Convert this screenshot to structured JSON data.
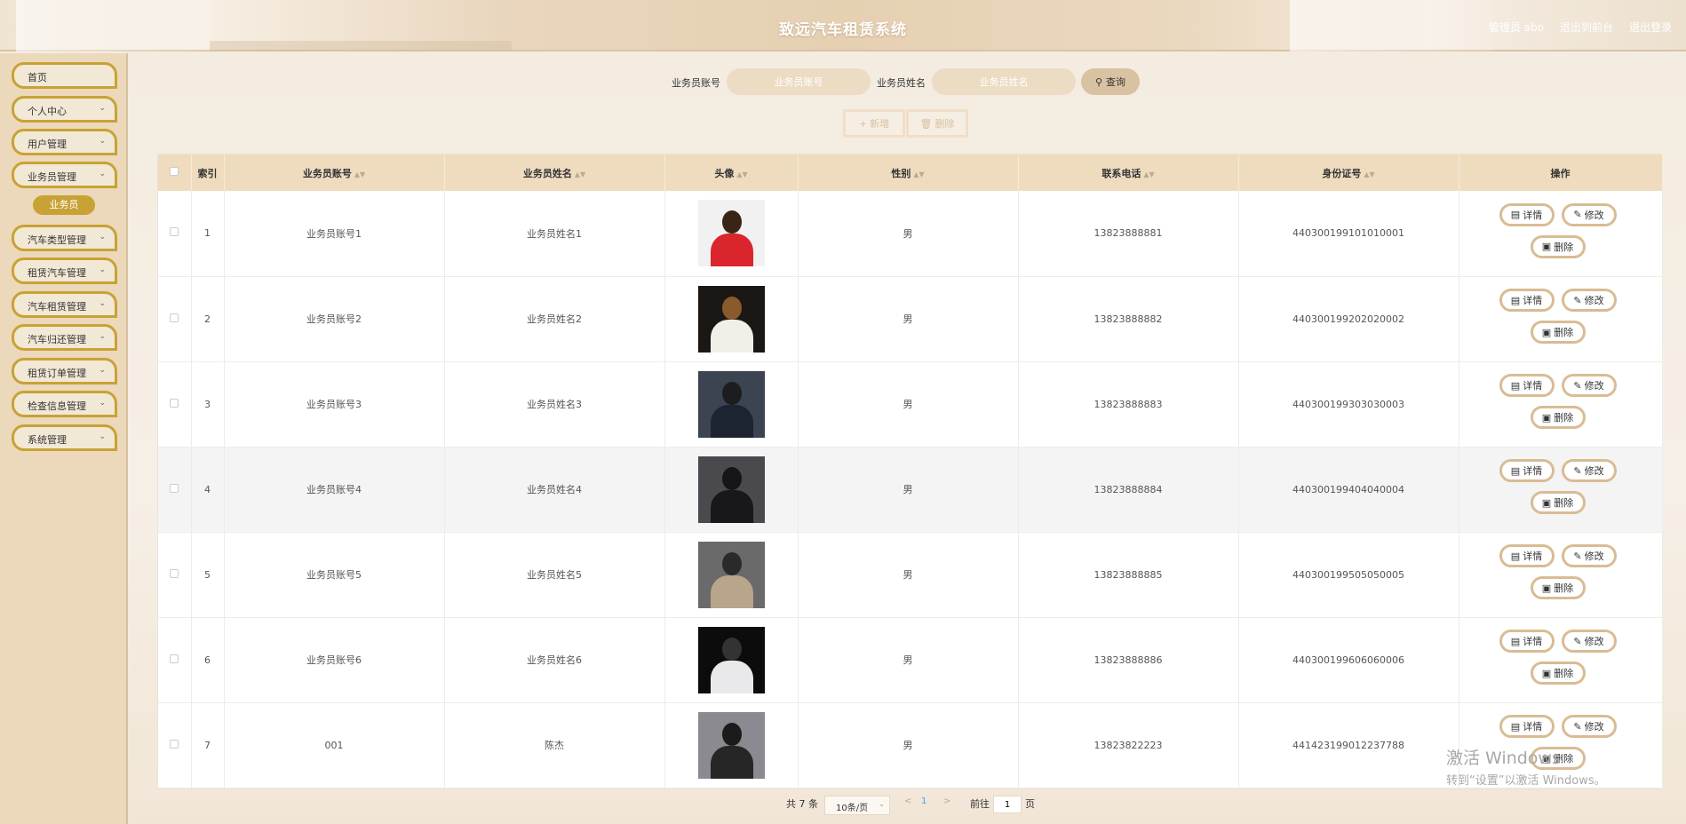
{
  "header": {
    "title": "致远汽车租赁系统",
    "user_label": "管理员 abo",
    "back_to_front": "退出到前台",
    "logout": "退出登录"
  },
  "sidebar": {
    "items": [
      {
        "label": "首页",
        "has_chevron": false
      },
      {
        "label": "个人中心",
        "has_chevron": true
      },
      {
        "label": "用户管理",
        "has_chevron": true
      },
      {
        "label": "业务员管理",
        "has_chevron": true
      },
      {
        "label": "汽车类型管理",
        "has_chevron": true
      },
      {
        "label": "租赁汽车管理",
        "has_chevron": true
      },
      {
        "label": "汽车租赁管理",
        "has_chevron": true
      },
      {
        "label": "汽车归还管理",
        "has_chevron": true
      },
      {
        "label": "租赁订单管理",
        "has_chevron": true
      },
      {
        "label": "检查信息管理",
        "has_chevron": true
      },
      {
        "label": "系统管理",
        "has_chevron": true
      }
    ],
    "active_sub": "业务员"
  },
  "search": {
    "account_label": "业务员账号",
    "account_placeholder": "业务员账号",
    "name_label": "业务员姓名",
    "name_placeholder": "业务员姓名",
    "query_button": "查询",
    "add_button": "新增",
    "delete_button": "删除"
  },
  "table": {
    "columns": [
      "索引",
      "业务员账号",
      "业务员姓名",
      "头像",
      "性别",
      "联系电话",
      "身份证号",
      "操作"
    ],
    "rows": [
      {
        "index": "1",
        "account": "业务员账号1",
        "name": "业务员姓名1",
        "gender": "男",
        "phone": "13823888881",
        "id_card": "440300199101010001"
      },
      {
        "index": "2",
        "account": "业务员账号2",
        "name": "业务员姓名2",
        "gender": "男",
        "phone": "13823888882",
        "id_card": "440300199202020002"
      },
      {
        "index": "3",
        "account": "业务员账号3",
        "name": "业务员姓名3",
        "gender": "男",
        "phone": "13823888883",
        "id_card": "440300199303030003"
      },
      {
        "index": "4",
        "account": "业务员账号4",
        "name": "业务员姓名4",
        "gender": "男",
        "phone": "13823888884",
        "id_card": "440300199404040004"
      },
      {
        "index": "5",
        "account": "业务员账号5",
        "name": "业务员姓名5",
        "gender": "男",
        "phone": "13823888885",
        "id_card": "440300199505050005"
      },
      {
        "index": "6",
        "account": "业务员账号6",
        "name": "业务员姓名6",
        "gender": "男",
        "phone": "13823888886",
        "id_card": "440300199606060006"
      },
      {
        "index": "7",
        "account": "001",
        "name": "陈杰",
        "gender": "男",
        "phone": "13823822223",
        "id_card": "441423199012237788"
      }
    ],
    "op_detail": "详情",
    "op_edit": "修改",
    "op_delete": "删除",
    "avatar_colors": [
      {
        "bg": "#f1f1f1",
        "hair": "#3a2418",
        "cloth": "#d9252b"
      },
      {
        "bg": "#1a1714",
        "hair": "#8a5a2c",
        "cloth": "#f2efe9"
      },
      {
        "bg": "#3b4450",
        "hair": "#1d1d1f",
        "cloth": "#1c2431"
      },
      {
        "bg": "#4a4a4e",
        "hair": "#161616",
        "cloth": "#18181a"
      },
      {
        "bg": "#6a6a6a",
        "hair": "#2a2a2a",
        "cloth": "#b9a58c"
      },
      {
        "bg": "#0c0c0c",
        "hair": "#333333",
        "cloth": "#e9e9ec"
      },
      {
        "bg": "#8a8a90",
        "hair": "#1b1b1b",
        "cloth": "#262626"
      }
    ]
  },
  "pagination": {
    "total": "共 7 条",
    "page_size": "10条/页",
    "current_page": "1",
    "goto_label": "前往",
    "goto_value": "1",
    "page_unit": "页"
  },
  "watermark": {
    "line1": "激活 Windows",
    "line2": "转到“设置”以激活 Windows。"
  }
}
